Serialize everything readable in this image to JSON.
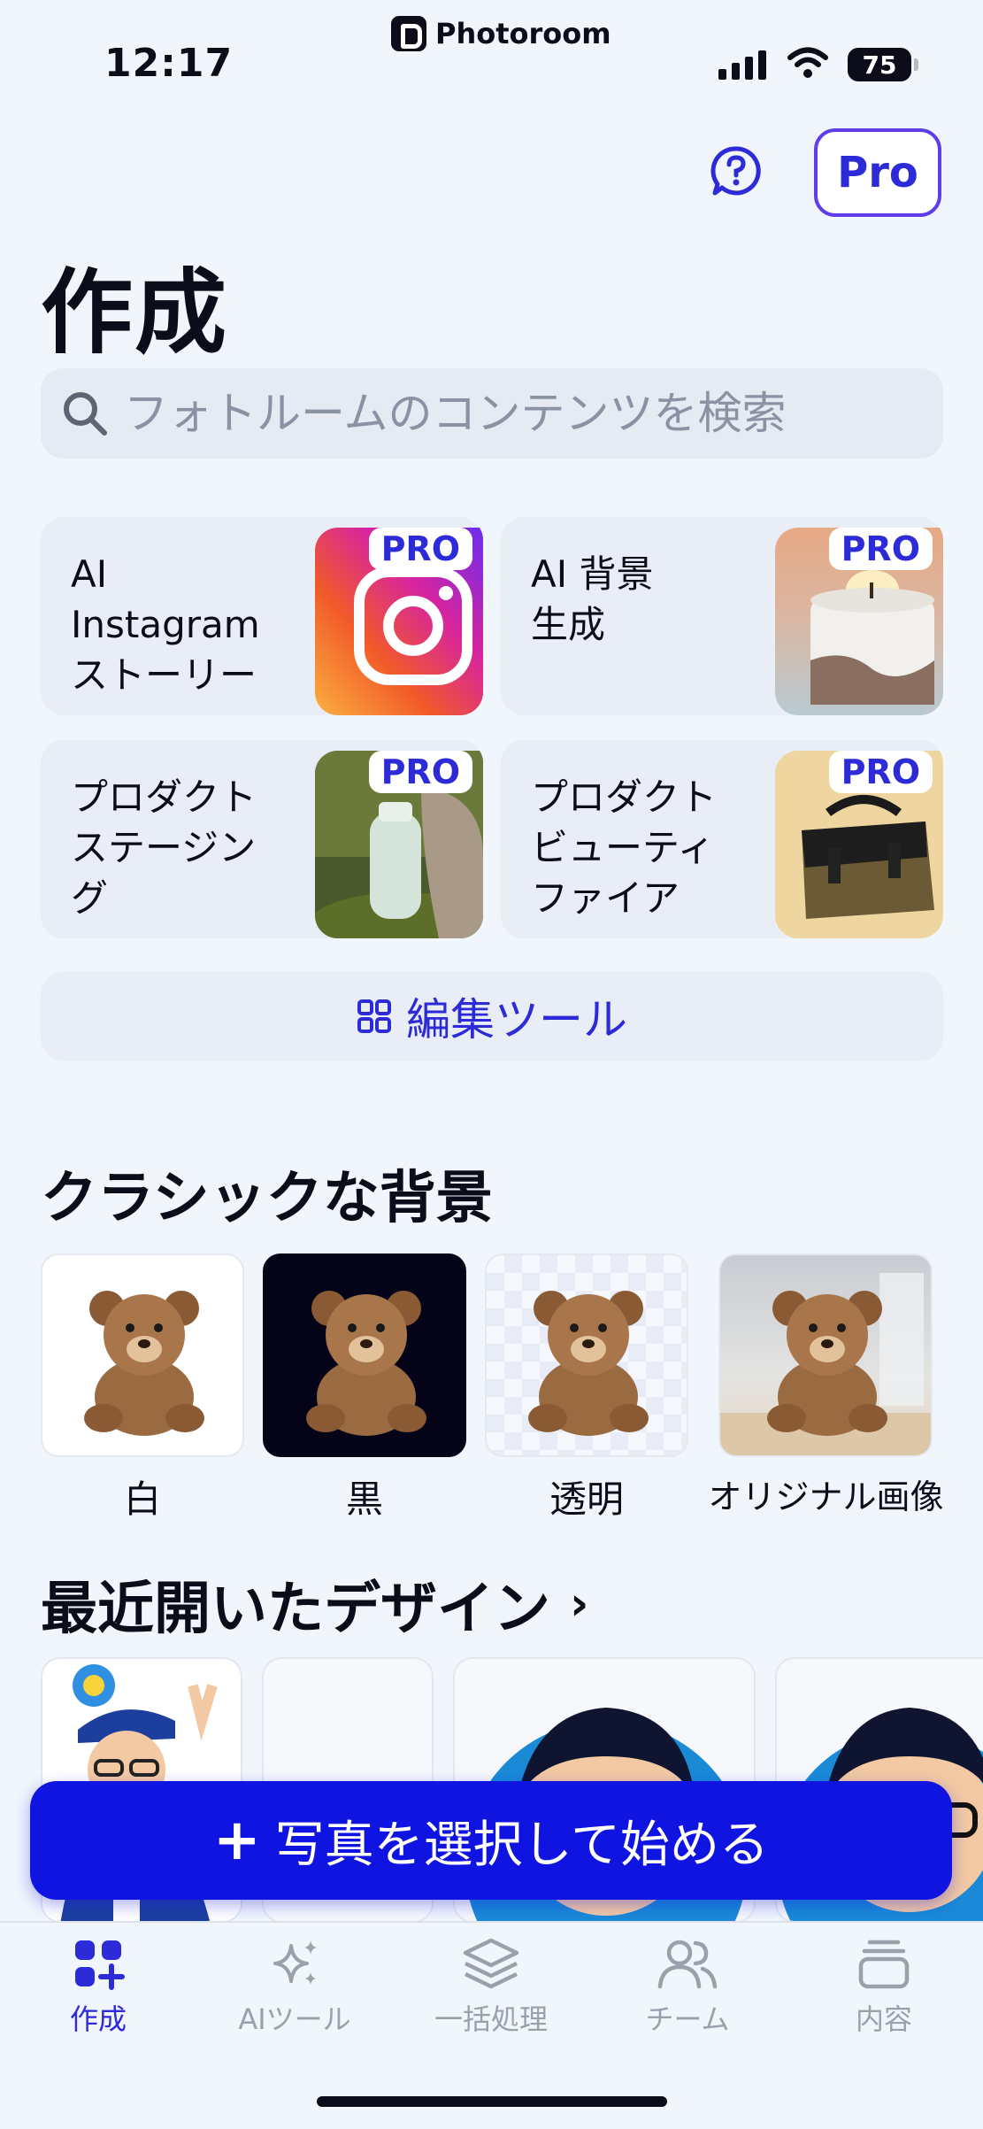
{
  "status_bar": {
    "time": "12:17",
    "app_name": "Photoroom",
    "battery": "75"
  },
  "header": {
    "pro_label": "Pro",
    "title": "作成"
  },
  "search": {
    "placeholder": "フォトルームのコンテンツを検索"
  },
  "feature_cards": [
    {
      "label": "AI\nInstagram\nストーリー",
      "badge": "PRO"
    },
    {
      "label": "AI 背景\n生成",
      "badge": "PRO"
    },
    {
      "label": "プロダクト\nステージン\nグ",
      "badge": "PRO"
    },
    {
      "label": "プロダクト\nビューティ\nファイア",
      "badge": "PRO"
    }
  ],
  "edit_tools_label": "編集ツール",
  "classic_backgrounds": {
    "title": "クラシックな背景",
    "items": [
      {
        "label": "白"
      },
      {
        "label": "黒"
      },
      {
        "label": "透明"
      },
      {
        "label": "オリジナル画像"
      }
    ]
  },
  "recent_designs": {
    "title": "最近開いたデザイン",
    "chevron": "›"
  },
  "cta": {
    "plus": "+",
    "label": "写真を選択して始める"
  },
  "tabs": [
    {
      "label": "作成",
      "icon": "create-grid-icon",
      "active": true
    },
    {
      "label": "AIツール",
      "icon": "sparkles-icon",
      "active": false
    },
    {
      "label": "一括処理",
      "icon": "layers-icon",
      "active": false
    },
    {
      "label": "チーム",
      "icon": "people-icon",
      "active": false
    },
    {
      "label": "内容",
      "icon": "stack-icon",
      "active": false
    }
  ],
  "colors": {
    "accent": "#2d2bd8",
    "cta": "#1014e0",
    "background": "#f1f5fc",
    "card": "#e9eef6"
  }
}
